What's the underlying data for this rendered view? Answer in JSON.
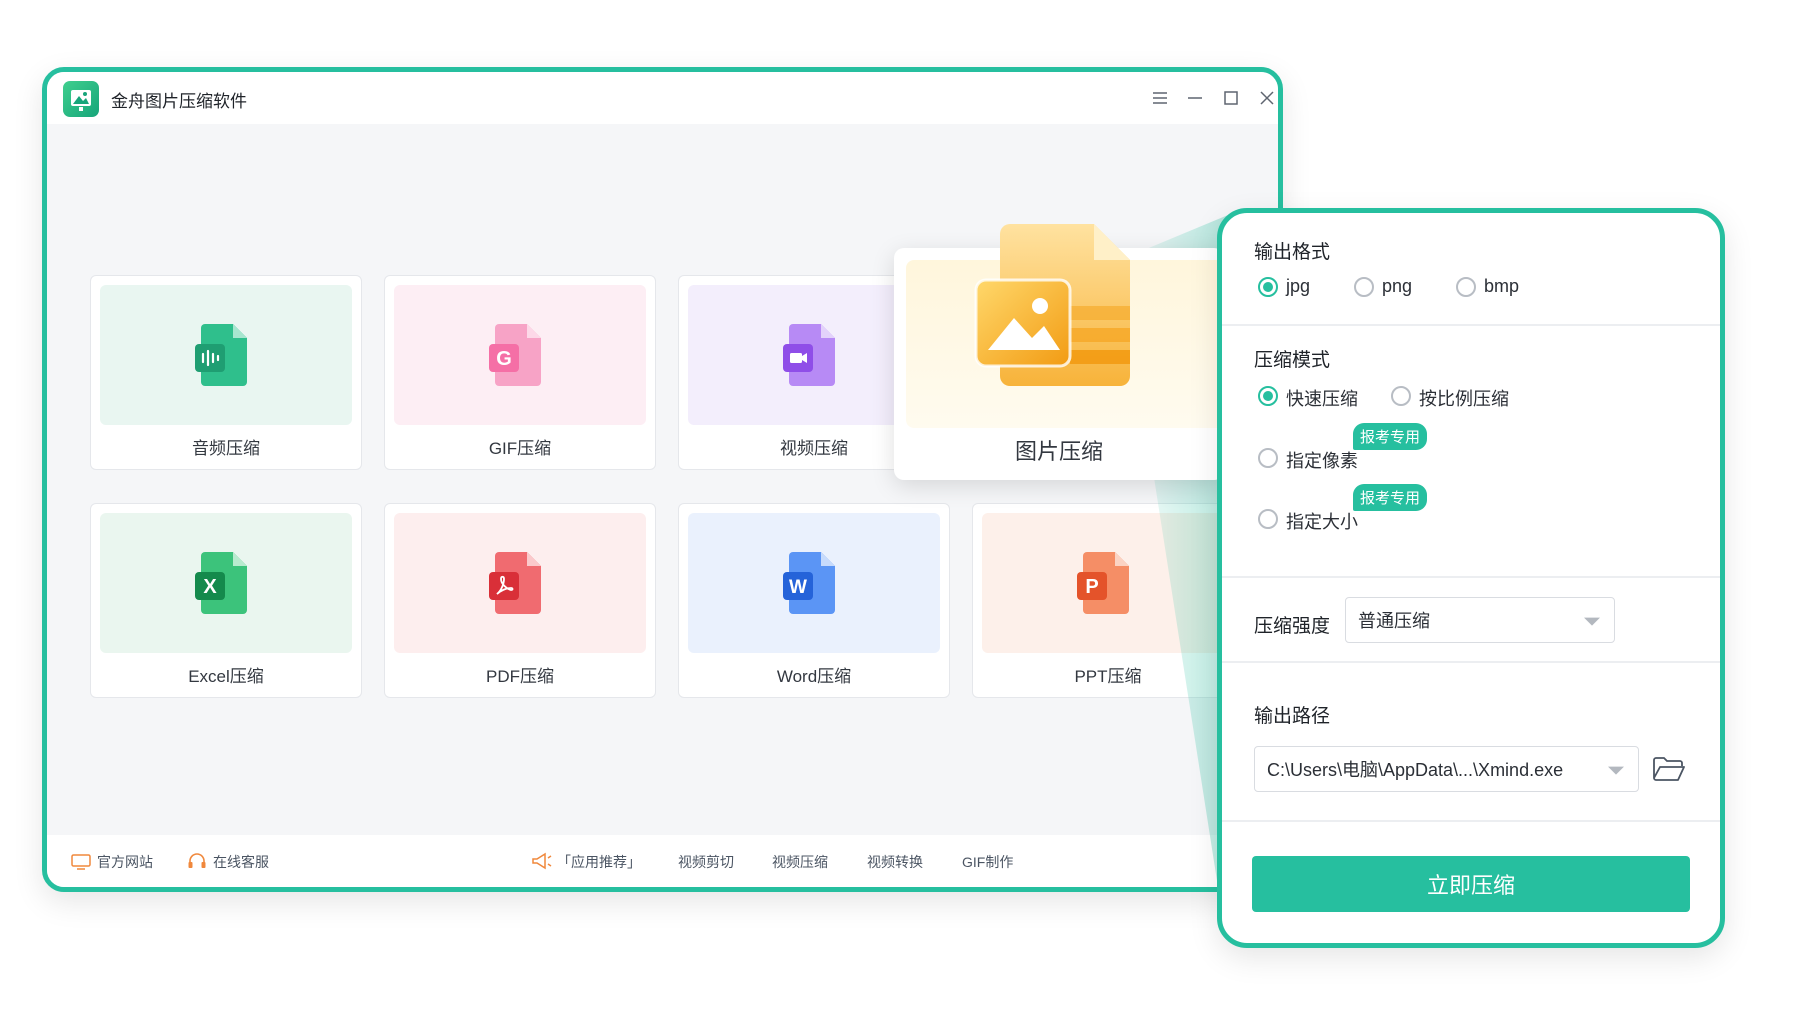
{
  "app": {
    "title": "金舟图片压缩软件"
  },
  "tools": [
    {
      "label": "音频压缩",
      "color": "#2fbf8c",
      "bg": "#e9f6f1",
      "glyph": "∥"
    },
    {
      "label": "GIF压缩",
      "color": "#f56fa6",
      "bg": "#fdeef4",
      "glyph": "G"
    },
    {
      "label": "视频压缩",
      "color": "#9b5cf0",
      "bg": "#f3eefc",
      "glyph": "▶"
    },
    {
      "label": "Excel压缩",
      "color": "#1fae64",
      "bg": "#eaf6ef",
      "glyph": "X"
    },
    {
      "label": "PDF压缩",
      "color": "#ea3c45",
      "bg": "#fdeeee",
      "glyph": "⅄"
    },
    {
      "label": "Word压缩",
      "color": "#3b7bf0",
      "bg": "#eaf1fd",
      "glyph": "W"
    },
    {
      "label": "PPT压缩",
      "color": "#f2673c",
      "bg": "#fdf0ea",
      "glyph": "P"
    }
  ],
  "featured": {
    "label": "图片压缩"
  },
  "footer": {
    "website": "官方网站",
    "support": "在线客服",
    "recommend": "「应用推荐」",
    "links": [
      "视频剪切",
      "视频压缩",
      "视频转换",
      "GIF制作"
    ]
  },
  "panel": {
    "output_format": {
      "title": "输出格式",
      "options": [
        "jpg",
        "png",
        "bmp"
      ],
      "selected": "jpg"
    },
    "compress_mode": {
      "title": "压缩模式",
      "fast": "快速压缩",
      "ratio": "按比例压缩",
      "pixel": "指定像素",
      "size": "指定大小",
      "badge": "报考专用",
      "selected": "快速压缩"
    },
    "strength": {
      "title": "压缩强度",
      "value": "普通压缩"
    },
    "output_path": {
      "title": "输出路径",
      "value": "C:\\Users\\电脑\\AppData\\...\\Xmind.exe"
    },
    "submit_label": "立即压缩"
  },
  "colors": {
    "accent": "#26bf9f"
  }
}
